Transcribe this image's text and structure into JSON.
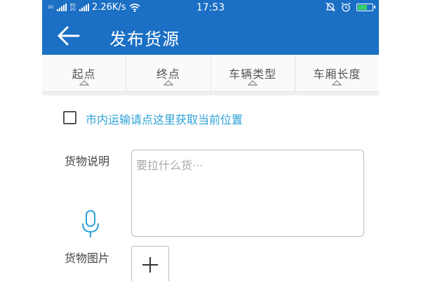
{
  "status_bar": {
    "signal_labels": [
      "2G",
      "4G",
      "2G"
    ],
    "network_speed": "2.26K/s",
    "time": "17:53",
    "battery_level": 0.7,
    "icons": [
      "signal-icon",
      "wifi-icon",
      "bell-off-icon",
      "alarm-icon",
      "battery-icon"
    ]
  },
  "header": {
    "title": "发布货源",
    "back_icon": "arrow-left-icon"
  },
  "filters": [
    {
      "label": "起点"
    },
    {
      "label": "终点"
    },
    {
      "label": "车辆类型"
    },
    {
      "label": "车厢长度"
    }
  ],
  "form": {
    "city_transport_label": "市内运输请点这里获取当前位置",
    "city_transport_checked": false,
    "cargo_desc_label": "货物说明",
    "cargo_desc_placeholder": "要拉什么货···",
    "cargo_desc_value": "",
    "cargo_image_label": "货物图片"
  },
  "colors": {
    "primary": "#1b6fc4",
    "link": "#2da2d8",
    "battery_fill": "#37d067"
  }
}
